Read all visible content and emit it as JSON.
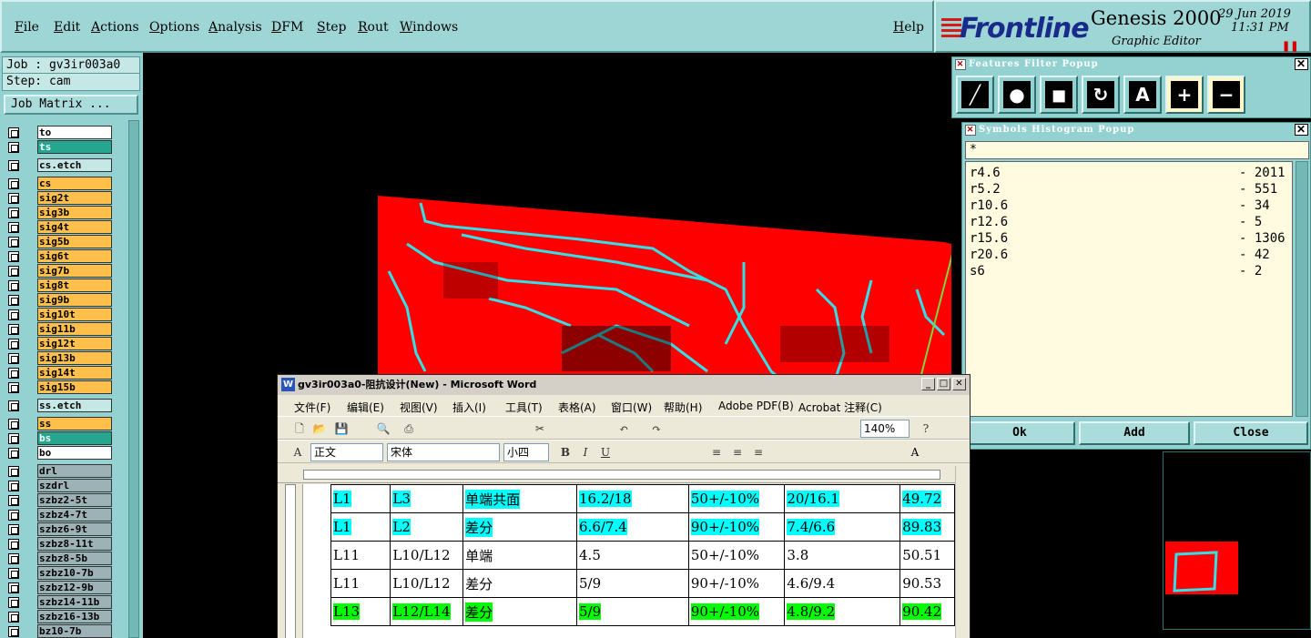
{
  "menubar": {
    "items": [
      "File",
      "Edit",
      "Actions",
      "Options",
      "Analysis",
      "DFM",
      "Step",
      "Rout",
      "Windows"
    ],
    "help": "Help"
  },
  "brand": {
    "logo": "Frontline",
    "product": "Genesis 2000",
    "subtitle": "Graphic Editor",
    "date": "29 Jun 2019",
    "time": "11:31 PM"
  },
  "job": {
    "job_label": "Job : gv3ir003a0",
    "step_label": "Step: cam",
    "matrix_button": "Job Matrix ..."
  },
  "layers": [
    {
      "name": "to",
      "type": "white"
    },
    {
      "name": "ts",
      "type": "teal"
    },
    {
      "name": "cs.etch",
      "type": "tealt"
    },
    {
      "name": "cs",
      "type": "board"
    },
    {
      "name": "sig2t",
      "type": "board"
    },
    {
      "name": "sig3b",
      "type": "board"
    },
    {
      "name": "sig4t",
      "type": "board"
    },
    {
      "name": "sig5b",
      "type": "board"
    },
    {
      "name": "sig6t",
      "type": "board"
    },
    {
      "name": "sig7b",
      "type": "board"
    },
    {
      "name": "sig8t",
      "type": "board"
    },
    {
      "name": "sig9b",
      "type": "board"
    },
    {
      "name": "sig10t",
      "type": "board"
    },
    {
      "name": "sig11b",
      "type": "board"
    },
    {
      "name": "sig12t",
      "type": "board"
    },
    {
      "name": "sig13b",
      "type": "board"
    },
    {
      "name": "sig14t",
      "type": "board"
    },
    {
      "name": "sig15b",
      "type": "board"
    },
    {
      "name": "ss.etch",
      "type": "tealt"
    },
    {
      "name": "ss",
      "type": "board"
    },
    {
      "name": "bs",
      "type": "teal"
    },
    {
      "name": "bo",
      "type": "white"
    },
    {
      "name": "drl",
      "type": "drill"
    },
    {
      "name": "szdrl",
      "type": "drill"
    },
    {
      "name": "szbz2-5t",
      "type": "drill"
    },
    {
      "name": "szbz4-7t",
      "type": "drill"
    },
    {
      "name": "szbz6-9t",
      "type": "drill"
    },
    {
      "name": "szbz8-11t",
      "type": "drill"
    },
    {
      "name": "szbz8-5b",
      "type": "drill"
    },
    {
      "name": "szbz10-7b",
      "type": "drill"
    },
    {
      "name": "szbz12-9b",
      "type": "drill"
    },
    {
      "name": "szbz14-11b",
      "type": "drill"
    },
    {
      "name": "szbz16-13b",
      "type": "drill"
    },
    {
      "name": "bz10-7b",
      "type": "drill"
    }
  ],
  "features_filter": {
    "title": "Features Filter Popup",
    "tools": [
      "line-tool",
      "pad-tool",
      "surface-tool",
      "arc-tool",
      "text-tool",
      "plus-tool",
      "minus-tool"
    ],
    "tool_glyphs": [
      "╱",
      "●",
      "◼",
      "↻",
      "A",
      "+",
      "−"
    ]
  },
  "symbols_histogram": {
    "title": "Symbols Histogram Popup",
    "filter": "*",
    "rows": [
      {
        "symbol": "r4.6",
        "count": "- 2011"
      },
      {
        "symbol": "r5.2",
        "count": "- 551"
      },
      {
        "symbol": "r10.6",
        "count": "- 34"
      },
      {
        "symbol": "r12.6",
        "count": "- 5"
      },
      {
        "symbol": "r15.6",
        "count": "- 1306"
      },
      {
        "symbol": "r20.6",
        "count": "- 42"
      },
      {
        "symbol": "s6",
        "count": "- 2"
      }
    ],
    "buttons": {
      "ok": "Ok",
      "add": "Add",
      "close": "Close"
    }
  },
  "word": {
    "title": "gv3ir003a0-阻抗设计(New) - Microsoft Word",
    "menu": [
      "文件(F)",
      "编辑(E)",
      "视图(V)",
      "插入(I)",
      "工具(T)",
      "表格(A)",
      "窗口(W)",
      "帮助(H)",
      "Adobe PDF(B)",
      "Acrobat 注释(C)"
    ],
    "zoom": "140%",
    "style": "正文",
    "font": "宋体",
    "size": "小四",
    "table_rows": [
      {
        "hl": "hc",
        "cells": [
          "L1",
          "L3",
          "单端共面",
          "16.2/18",
          "50+/-10%",
          "20/16.1",
          "49.72"
        ]
      },
      {
        "hl": "hc",
        "cells": [
          "L1",
          "L2",
          "差分",
          "6.6/7.4",
          "90+/-10%",
          "7.4/6.6",
          "89.83"
        ]
      },
      {
        "hl": "",
        "cells": [
          "L11",
          "L10/L12",
          "单端",
          "4.5",
          "50+/-10%",
          "3.8",
          "50.51"
        ]
      },
      {
        "hl": "",
        "cells": [
          "L11",
          "L10/L12",
          "差分",
          "5/9",
          "90+/-10%",
          "4.6/9.4",
          "90.53"
        ]
      },
      {
        "hl": "hg",
        "cells": [
          "L13",
          "L12/L14",
          "差分",
          "5/9",
          "90+/-10%",
          "4.8/9.2",
          "90.42"
        ]
      }
    ]
  }
}
